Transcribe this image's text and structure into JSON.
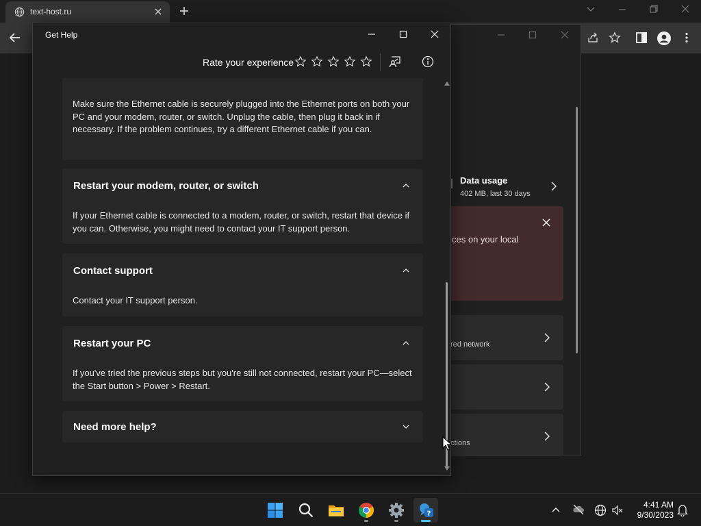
{
  "browser": {
    "tab_title": "text-host.ru"
  },
  "settings": {
    "data_usage_title": "Data usage",
    "data_usage_sub": "402 MB, last 30 days",
    "banner_text": "ces on your local",
    "card1_text": "red network",
    "card3_text": "ctions"
  },
  "gethelp": {
    "window_title": "Get Help",
    "rate_label": "Rate your experience",
    "stars": 5,
    "sections": [
      {
        "title": "",
        "body": "Make sure the Ethernet cable is securely plugged into the Ethernet ports on both your PC and your modem, router, or switch. Unplug the cable, then plug it back in if necessary. If the problem continues, try a different Ethernet cable if you can.",
        "expanded": true
      },
      {
        "title": "Restart your modem, router, or switch",
        "body": "If your Ethernet cable is connected to a modem, router, or switch, restart that device if you can. Otherwise, you might need to contact your IT support person.",
        "expanded": true
      },
      {
        "title": "Contact support",
        "body": "Contact your IT support person.",
        "expanded": true
      },
      {
        "title": "Restart your PC",
        "body": "If you've tried the previous steps but you're still not connected, restart your PC—select the Start button > Power > Restart.",
        "expanded": true
      },
      {
        "title": "Need more help?",
        "body": "",
        "expanded": false
      }
    ]
  },
  "taskbar": {
    "time": "4:41 AM",
    "date": "9/30/2023",
    "apps": [
      "start-icon",
      "search-icon",
      "file-explorer-icon",
      "chrome-icon",
      "settings-icon",
      "get-help-icon"
    ]
  },
  "colors": {
    "accent": "#4cc2ff",
    "banner": "#432a2d",
    "card": "#272727"
  }
}
